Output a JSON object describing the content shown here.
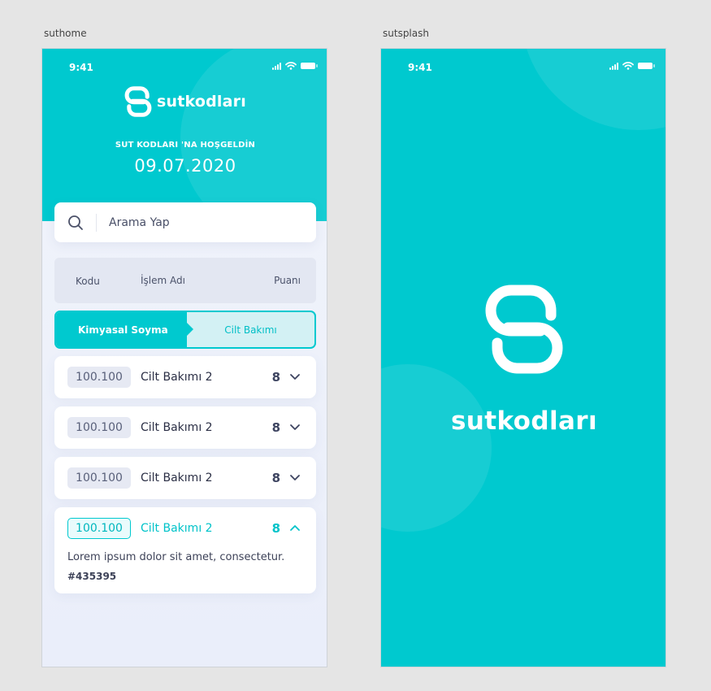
{
  "artboards": {
    "home_label": "suthome",
    "splash_label": "sutsplash"
  },
  "status_bar": {
    "time": "9:41",
    "icons": [
      "signal-icon",
      "wifi-icon",
      "battery-icon"
    ]
  },
  "brand": {
    "name": "sutkodları",
    "logo_icon": "s-logo-icon"
  },
  "home": {
    "welcome": "SUT KODLARI 'NA HOŞGELDİN",
    "date": "09.07.2020",
    "search": {
      "placeholder": "Arama Yap",
      "icon": "search-icon"
    },
    "table_header": {
      "code": "Kodu",
      "name": "İşlem Adı",
      "score": "Puanı"
    },
    "tabs": [
      {
        "label": "Kimyasal Soyma",
        "active": true
      },
      {
        "label": "Cilt Bakımı",
        "active": false
      }
    ],
    "rows": [
      {
        "code": "100.100",
        "name": "Cilt Bakımı 2",
        "score": "8",
        "expanded": false
      },
      {
        "code": "100.100",
        "name": "Cilt Bakımı 2",
        "score": "8",
        "expanded": false
      },
      {
        "code": "100.100",
        "name": "Cilt Bakımı 2",
        "score": "8",
        "expanded": false
      },
      {
        "code": "100.100",
        "name": "Cilt Bakımı 2",
        "score": "8",
        "expanded": true,
        "description": "Lorem ipsum dolor sit amet, consectetur.",
        "hash": "#435395"
      }
    ]
  },
  "splash": {
    "name": "sutkodları"
  },
  "colors": {
    "primary": "#00c9cf",
    "background": "#e5e5e5",
    "text_dark": "#2b2f45",
    "badge_bg": "#e6e9f3",
    "header_row_bg": "#e3e7f2",
    "tab_inactive_bg": "#d3f1f4"
  }
}
